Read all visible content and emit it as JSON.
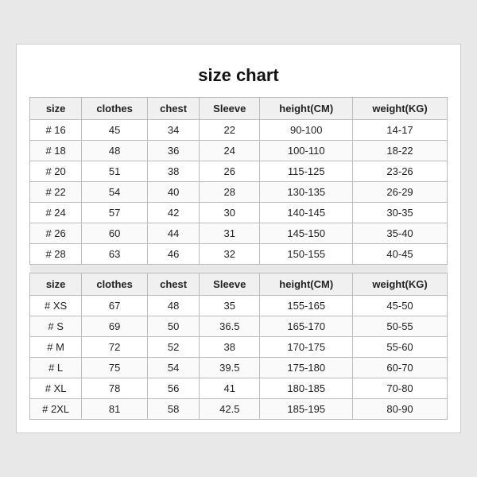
{
  "title": "size chart",
  "headers": [
    "size",
    "clothes",
    "chest",
    "Sleeve",
    "height(CM)",
    "weight(KG)"
  ],
  "section1": [
    {
      "size": "# 16",
      "clothes": "45",
      "chest": "34",
      "sleeve": "22",
      "height": "90-100",
      "weight": "14-17"
    },
    {
      "size": "# 18",
      "clothes": "48",
      "chest": "36",
      "sleeve": "24",
      "height": "100-110",
      "weight": "18-22"
    },
    {
      "size": "# 20",
      "clothes": "51",
      "chest": "38",
      "sleeve": "26",
      "height": "115-125",
      "weight": "23-26"
    },
    {
      "size": "# 22",
      "clothes": "54",
      "chest": "40",
      "sleeve": "28",
      "height": "130-135",
      "weight": "26-29"
    },
    {
      "size": "# 24",
      "clothes": "57",
      "chest": "42",
      "sleeve": "30",
      "height": "140-145",
      "weight": "30-35"
    },
    {
      "size": "# 26",
      "clothes": "60",
      "chest": "44",
      "sleeve": "31",
      "height": "145-150",
      "weight": "35-40"
    },
    {
      "size": "# 28",
      "clothes": "63",
      "chest": "46",
      "sleeve": "32",
      "height": "150-155",
      "weight": "40-45"
    }
  ],
  "section2": [
    {
      "size": "# XS",
      "clothes": "67",
      "chest": "48",
      "sleeve": "35",
      "height": "155-165",
      "weight": "45-50"
    },
    {
      "size": "# S",
      "clothes": "69",
      "chest": "50",
      "sleeve": "36.5",
      "height": "165-170",
      "weight": "50-55"
    },
    {
      "size": "# M",
      "clothes": "72",
      "chest": "52",
      "sleeve": "38",
      "height": "170-175",
      "weight": "55-60"
    },
    {
      "size": "# L",
      "clothes": "75",
      "chest": "54",
      "sleeve": "39.5",
      "height": "175-180",
      "weight": "60-70"
    },
    {
      "size": "# XL",
      "clothes": "78",
      "chest": "56",
      "sleeve": "41",
      "height": "180-185",
      "weight": "70-80"
    },
    {
      "size": "# 2XL",
      "clothes": "81",
      "chest": "58",
      "sleeve": "42.5",
      "height": "185-195",
      "weight": "80-90"
    }
  ]
}
